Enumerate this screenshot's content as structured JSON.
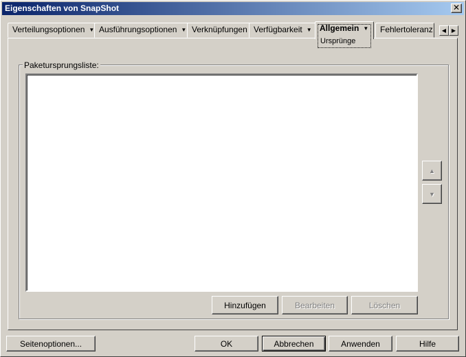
{
  "window": {
    "title": "Eigenschaften von SnapShot",
    "close_glyph": "✕"
  },
  "tabs": [
    {
      "label": "Verteilungsoptionen",
      "has_menu": true
    },
    {
      "label": "Ausführungsoptionen",
      "has_menu": true
    },
    {
      "label": "Verknüpfungen",
      "has_menu": false
    },
    {
      "label": "Verfügbarkeit",
      "has_menu": true
    },
    {
      "label": "Allgemein",
      "has_menu": true,
      "active": true
    },
    {
      "label": "Fehlertoleranz",
      "has_menu": false
    }
  ],
  "active_subtab": "Ursprünge",
  "tab_scroll": {
    "left": "◀",
    "right": "▶"
  },
  "group": {
    "label": "Paketursprungsliste:"
  },
  "list": {
    "items": []
  },
  "list_buttons": {
    "add": "Hinzufügen",
    "edit": "Bearbeiten",
    "delete": "Löschen",
    "up": "▲",
    "down": "▼"
  },
  "footer": {
    "page_options": "Seitenoptionen...",
    "ok": "OK",
    "cancel": "Abbrechen",
    "apply": "Anwenden",
    "help": "Hilfe"
  },
  "colors": {
    "face": "#d4d0c8",
    "title_start": "#0a246a",
    "title_end": "#a6caf0"
  }
}
